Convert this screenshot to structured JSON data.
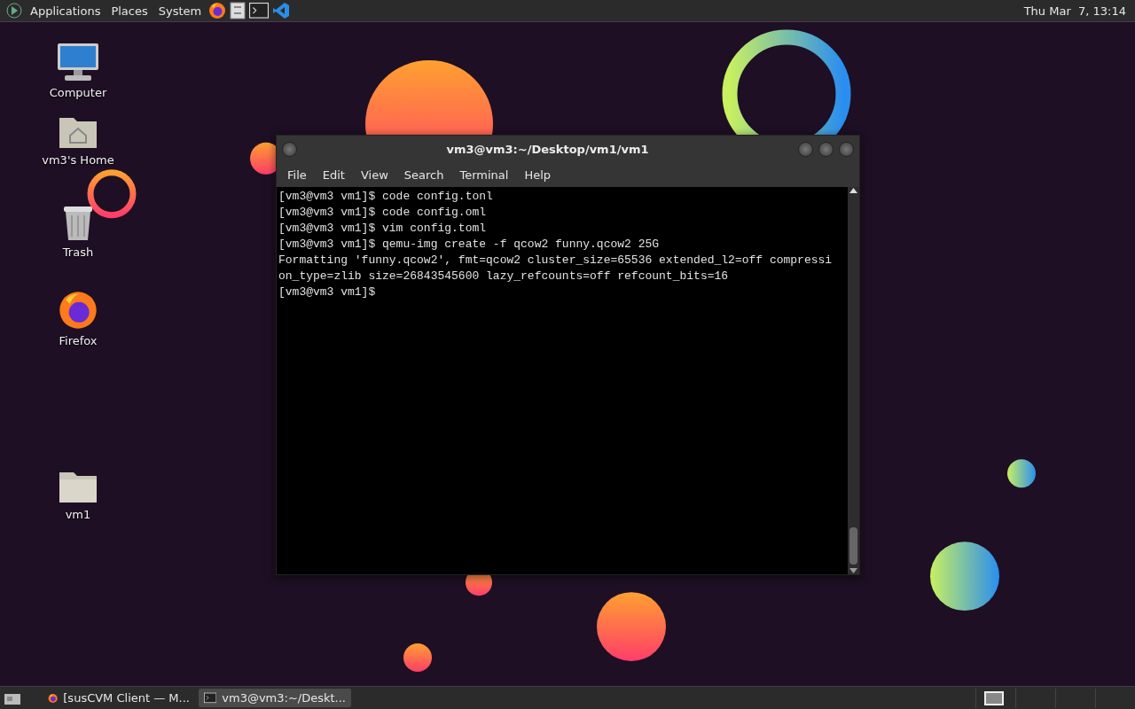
{
  "top_panel": {
    "menus": [
      "Applications",
      "Places",
      "System"
    ],
    "launchers": [
      {
        "kind": "firefox"
      },
      {
        "kind": "files"
      },
      {
        "kind": "terminal"
      },
      {
        "kind": "vscode"
      }
    ],
    "clock": "Thu Mar  7, 13:14"
  },
  "desktop_icons": [
    {
      "label": "Computer",
      "kind": "computer"
    },
    {
      "label": "vm3's Home",
      "kind": "home"
    },
    {
      "label": "Trash",
      "kind": "trash"
    },
    {
      "label": "Firefox",
      "kind": "firefox"
    },
    {
      "label": "vm1",
      "kind": "folder"
    }
  ],
  "terminal": {
    "title": "vm3@vm3:~/Desktop/vm1/vm1",
    "menu": [
      "File",
      "Edit",
      "View",
      "Search",
      "Terminal",
      "Help"
    ],
    "lines": [
      "[vm3@vm3 vm1]$ code config.tonl",
      "[vm3@vm3 vm1]$ code config.oml",
      "[vm3@vm3 vm1]$ vim config.toml",
      "[vm3@vm3 vm1]$ qemu-img create -f qcow2 funny.qcow2 25G",
      "Formatting 'funny.qcow2', fmt=qcow2 cluster_size=65536 extended_l2=off compressi",
      "on_type=zlib size=26843545600 lazy_refcounts=off refcount_bits=16",
      "[vm3@vm3 vm1]$"
    ]
  },
  "taskbar": {
    "windows": [
      {
        "label": "[susCVM Client — M...",
        "kind": "firefox",
        "selected": false
      },
      {
        "label": "vm3@vm3:~/Deskt...",
        "kind": "terminal",
        "selected": true
      }
    ],
    "workspaces": [
      {
        "selected": true
      },
      {
        "selected": false
      },
      {
        "selected": false
      },
      {
        "selected": false
      }
    ]
  }
}
